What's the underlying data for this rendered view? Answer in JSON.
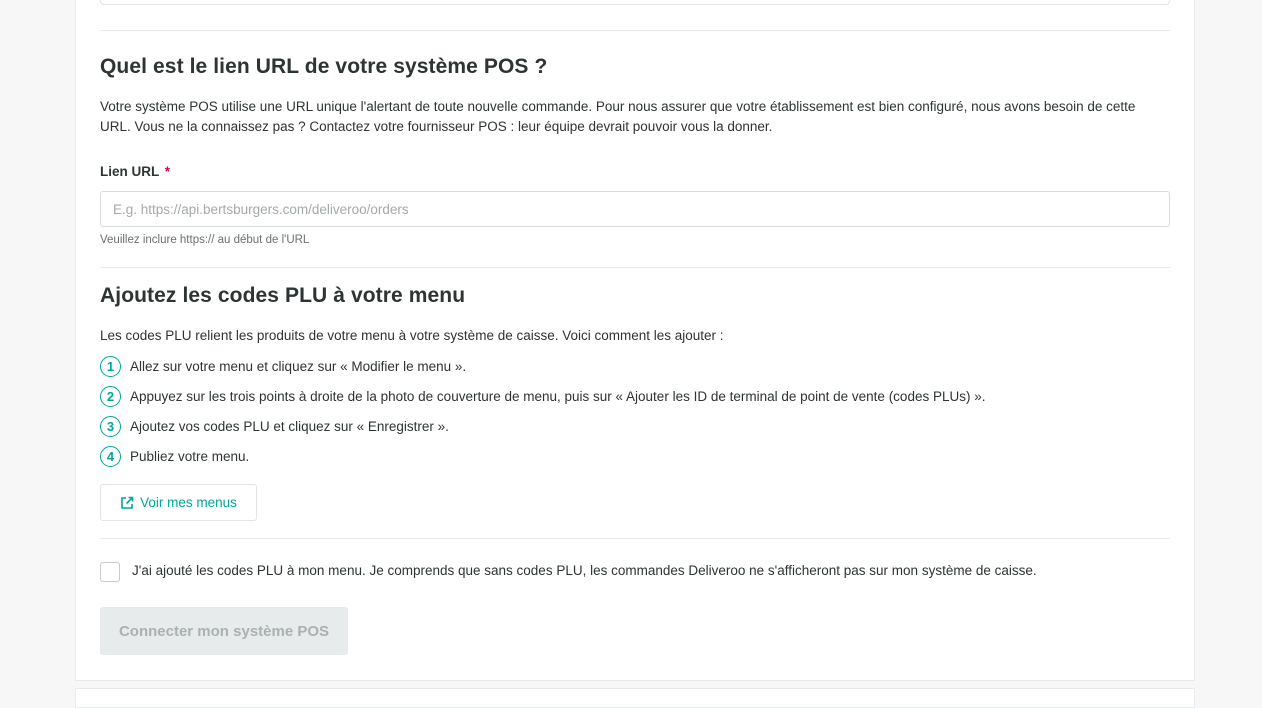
{
  "url_section": {
    "title": "Quel est le lien URL de votre système POS ?",
    "description": "Votre système POS utilise une URL unique l'alertant de toute nouvelle commande. Pour nous assurer que votre établissement est bien configuré, nous avons besoin de cette URL. Vous ne la connaissez pas ? Contactez votre fournisseur POS : leur équipe devrait pouvoir vous la donner.",
    "field_label": "Lien URL",
    "required_mark": "*",
    "input_value": "",
    "input_placeholder": "E.g. https://api.bertsburgers.com/deliveroo/orders",
    "hint": "Veuillez inclure https:// au début de l'URL"
  },
  "plu_section": {
    "title": "Ajoutez les codes PLU à votre menu",
    "intro": "Les codes PLU relient les produits de votre menu à votre système de caisse. Voici comment les ajouter :",
    "steps": [
      {
        "number": "1",
        "text": "Allez sur votre menu et cliquez sur « Modifier le menu »."
      },
      {
        "number": "2",
        "text": "Appuyez sur les trois points à droite de la photo de couverture de menu, puis sur « Ajouter les ID de terminal de point de vente (codes PLUs) »."
      },
      {
        "number": "3",
        "text": "Ajoutez vos codes PLU et cliquez sur « Enregistrer »."
      },
      {
        "number": "4",
        "text": "Publiez votre menu."
      }
    ],
    "menus_button": "Voir mes menus",
    "menus_button_icon": "external-link-icon"
  },
  "confirmation": {
    "checked": false,
    "label": "J'ai ajouté les codes PLU à mon menu. Je comprends que sans codes PLU, les commandes Deliveroo ne s'afficheront pas sur mon système de caisse."
  },
  "connect_button": {
    "label": "Connecter mon système POS",
    "disabled": true
  },
  "colors": {
    "accent": "#00a699",
    "required": "#e00051",
    "disabled_bg": "#e8ebeb",
    "disabled_text": "#abb0b0"
  }
}
